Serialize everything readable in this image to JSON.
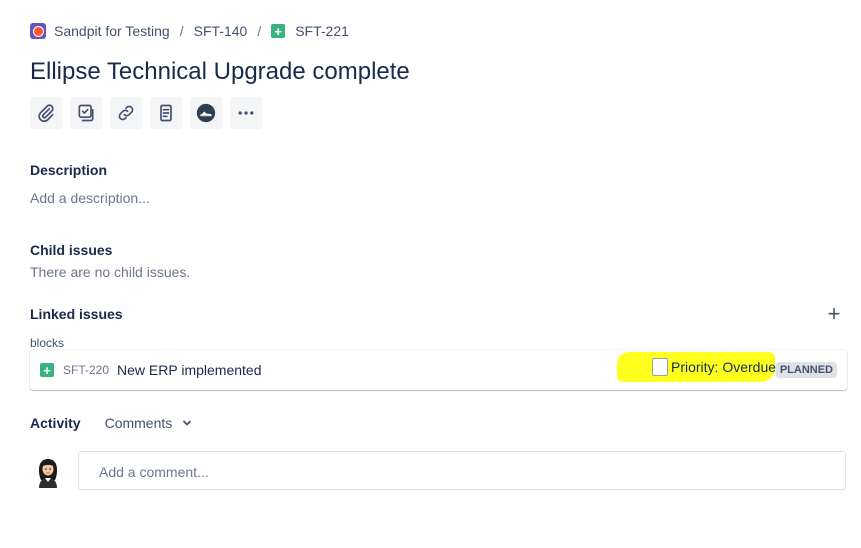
{
  "breadcrumb": {
    "project": "Sandpit for Testing",
    "separator": "/",
    "parent_key": "SFT-140",
    "issue_key": "SFT-221"
  },
  "issue": {
    "title": "Ellipse Technical Upgrade complete"
  },
  "toolbar": {
    "buttons": [
      "paperclip-icon",
      "checklist-icon",
      "link-icon",
      "document-icon",
      "shoe-app-icon",
      "more-icon"
    ]
  },
  "description": {
    "label": "Description",
    "placeholder": "Add a description..."
  },
  "child_issues": {
    "label": "Child issues",
    "empty_text": "There are no child issues."
  },
  "linked_issues": {
    "label": "Linked issues",
    "add_icon": "+",
    "link_type": "blocks",
    "items": [
      {
        "key": "SFT-220",
        "summary": "New ERP implemented",
        "priority_text": "Priority: Overdue",
        "status": "PLANNED"
      }
    ]
  },
  "activity": {
    "label": "Activity",
    "filter": "Comments",
    "comment_placeholder": "Add a comment..."
  },
  "colors": {
    "story_green": "#36b37e",
    "highlight_yellow": "#ffff1e",
    "lozenge_grey": "#dfe1e6",
    "text_primary": "#172b4d",
    "text_muted": "#6b778c"
  }
}
